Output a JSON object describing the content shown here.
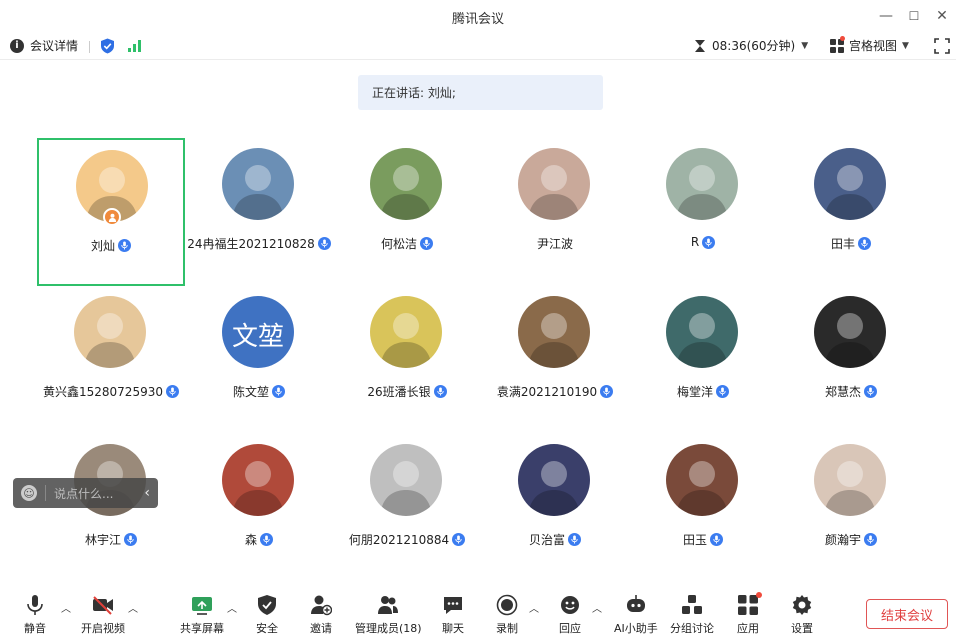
{
  "window": {
    "title": "腾讯会议",
    "minimize": "—",
    "maximize": "☐",
    "close": "✕"
  },
  "infobar": {
    "details_label": "会议详情",
    "timer": "08:36(60分钟)",
    "view_label": "宫格视图",
    "icons": [
      "info-icon",
      "shield-icon",
      "signal-icon",
      "hourglass-icon",
      "grid-view-icon",
      "fullscreen-icon"
    ]
  },
  "speaking": "正在讲话: 刘灿;",
  "participants": [
    {
      "name": "刘灿",
      "avatar_color": "#f4c98a",
      "mic": true,
      "host": true,
      "active": true
    },
    {
      "name": "24冉福生2021210828",
      "avatar_color": "#6b8fb5",
      "mic": true
    },
    {
      "name": "何松洁",
      "avatar_color": "#7a9c5e",
      "mic": true
    },
    {
      "name": "尹江波",
      "avatar_color": "#c9a99a",
      "mic": false
    },
    {
      "name": "R",
      "avatar_color": "#9fb3a6",
      "mic": true
    },
    {
      "name": "田丰",
      "avatar_color": "#4a5f8a",
      "mic": true
    },
    {
      "name": "黄兴鑫15280725930",
      "avatar_color": "#e6c79a",
      "mic": true
    },
    {
      "name": "陈文堃",
      "avatar_color": "#3f72c2",
      "avatar_text": "文堃",
      "mic": true
    },
    {
      "name": "26班潘长银",
      "avatar_color": "#d9c45a",
      "mic": true
    },
    {
      "name": "袁满2021210190",
      "avatar_color": "#8a6a4a",
      "mic": true
    },
    {
      "name": "梅堂洋",
      "avatar_color": "#3f6a6a",
      "mic": true
    },
    {
      "name": "郑慧杰",
      "avatar_color": "#2a2a2a",
      "mic": true
    },
    {
      "name": "林宇江",
      "avatar_color": "#9a8a7a",
      "mic": true
    },
    {
      "name": "森",
      "avatar_color": "#b04a3a",
      "mic": true
    },
    {
      "name": "何朋2021210884",
      "avatar_color": "#bfbfbf",
      "mic": true
    },
    {
      "name": "贝治富",
      "avatar_color": "#3a3f6a",
      "mic": true
    },
    {
      "name": "田玉",
      "avatar_color": "#7a4a3a",
      "mic": true
    },
    {
      "name": "颜瀚宇",
      "avatar_color": "#d9c6b8",
      "mic": true
    }
  ],
  "chat": {
    "placeholder": "说点什么..."
  },
  "toolbar": {
    "mute": "静音",
    "video": "开启视频",
    "share": "共享屏幕",
    "security": "安全",
    "invite": "邀请",
    "members": "管理成员(18)",
    "chat": "聊天",
    "record": "录制",
    "reaction": "回应",
    "ai": "AI小助手",
    "breakout": "分组讨论",
    "apps": "应用",
    "settings": "设置",
    "end": "结束会议"
  },
  "colors": {
    "accent": "#3b7cf0",
    "active_border": "#2fc06a",
    "end": "#e04040"
  }
}
